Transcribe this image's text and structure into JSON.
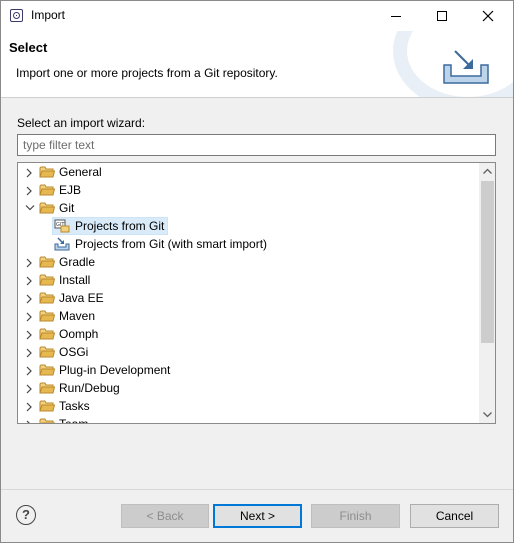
{
  "window": {
    "title": "Import",
    "controls": {
      "minimize": "minimize-icon",
      "maximize": "maximize-icon",
      "close": "close-icon"
    }
  },
  "header": {
    "title": "Select",
    "description": "Import one or more projects from a Git repository."
  },
  "wizard": {
    "label": "Select an import wizard:",
    "filter_placeholder": "type filter text",
    "filter_value": ""
  },
  "tree": {
    "items": [
      {
        "label": "General",
        "type": "folder",
        "expanded": false
      },
      {
        "label": "EJB",
        "type": "folder",
        "expanded": false
      },
      {
        "label": "Git",
        "type": "folder",
        "expanded": true
      },
      {
        "label": "Projects from Git",
        "type": "child",
        "selected": true
      },
      {
        "label": "Projects from Git (with smart import)",
        "type": "child",
        "selected": false
      },
      {
        "label": "Gradle",
        "type": "folder",
        "expanded": false
      },
      {
        "label": "Install",
        "type": "folder",
        "expanded": false
      },
      {
        "label": "Java EE",
        "type": "folder",
        "expanded": false
      },
      {
        "label": "Maven",
        "type": "folder",
        "expanded": false
      },
      {
        "label": "Oomph",
        "type": "folder",
        "expanded": false
      },
      {
        "label": "OSGi",
        "type": "folder",
        "expanded": false
      },
      {
        "label": "Plug-in Development",
        "type": "folder",
        "expanded": false
      },
      {
        "label": "Run/Debug",
        "type": "folder",
        "expanded": false
      },
      {
        "label": "Tasks",
        "type": "folder",
        "expanded": false
      },
      {
        "label": "Team",
        "type": "folder",
        "expanded": false
      }
    ]
  },
  "buttons": {
    "back": "< Back",
    "next": "Next >",
    "finish": "Finish",
    "cancel": "Cancel"
  },
  "colors": {
    "selection": "#d9ebf9",
    "default_button_border": "#0078d7",
    "folder": "#dcb05a"
  }
}
